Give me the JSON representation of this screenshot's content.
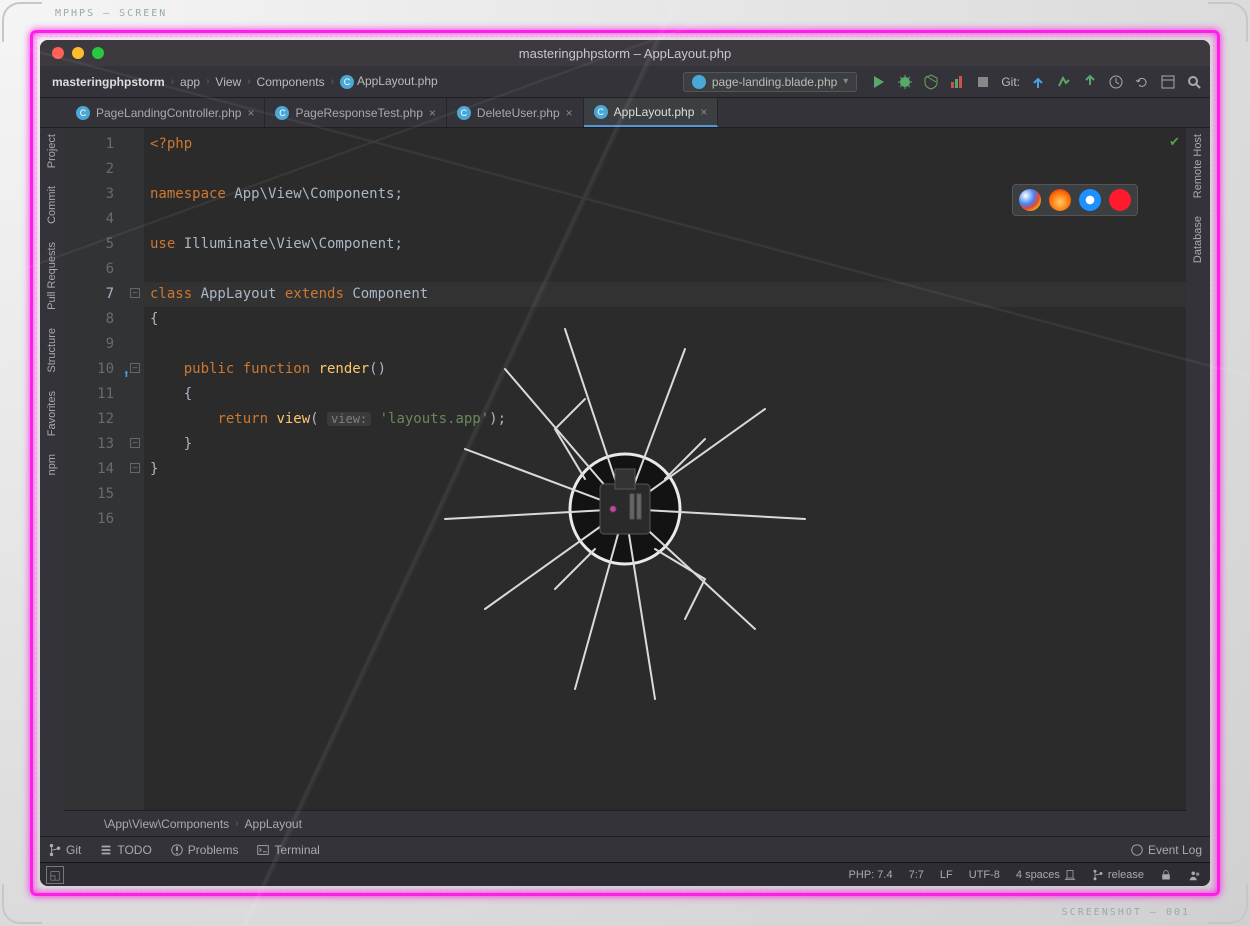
{
  "frame": {
    "label_tl": "MPHPS – SCREEN",
    "label_br": "SCREENSHOT – 001"
  },
  "window": {
    "title": "masteringphpstorm – AppLayout.php"
  },
  "breadcrumbs": [
    "masteringphpstorm",
    "app",
    "View",
    "Components",
    "AppLayout.php"
  ],
  "runconfig": {
    "label": "page-landing.blade.php"
  },
  "git": {
    "label": "Git:"
  },
  "tabs": [
    {
      "label": "PageLandingController.php",
      "active": false
    },
    {
      "label": "PageResponseTest.php",
      "active": false
    },
    {
      "label": "DeleteUser.php",
      "active": false
    },
    {
      "label": "AppLayout.php",
      "active": true
    }
  ],
  "leftrail": [
    {
      "label": "Project",
      "icon": "folder"
    },
    {
      "label": "Commit",
      "icon": "commit"
    },
    {
      "label": "Pull Requests",
      "icon": "pr"
    },
    {
      "label": "Structure",
      "icon": "structure"
    },
    {
      "label": "Favorites",
      "icon": "star"
    },
    {
      "label": "npm",
      "icon": "npm"
    }
  ],
  "rightrail": [
    {
      "label": "Remote Host",
      "icon": "remote"
    },
    {
      "label": "Database",
      "icon": "database"
    }
  ],
  "code": {
    "lines": [
      {
        "n": 1,
        "seg": [
          [
            "kw",
            "<?php"
          ]
        ]
      },
      {
        "n": 2,
        "seg": []
      },
      {
        "n": 3,
        "seg": [
          [
            "kw",
            "namespace "
          ],
          [
            "ns",
            "App\\View\\Components"
          ],
          [
            "pun",
            ";"
          ]
        ]
      },
      {
        "n": 4,
        "seg": []
      },
      {
        "n": 5,
        "seg": [
          [
            "kw",
            "use "
          ],
          [
            "ns",
            "Illuminate\\View\\Component"
          ],
          [
            "pun",
            ";"
          ]
        ]
      },
      {
        "n": 6,
        "seg": []
      },
      {
        "n": 7,
        "hl": true,
        "fold": true,
        "seg": [
          [
            "kw",
            "class "
          ],
          [
            "cls",
            "AppLayout "
          ],
          [
            "kw",
            "extends "
          ],
          [
            "ns",
            "Component"
          ]
        ]
      },
      {
        "n": 8,
        "seg": [
          [
            "pun",
            "{"
          ]
        ]
      },
      {
        "n": 9,
        "seg": []
      },
      {
        "n": 10,
        "override": true,
        "fold": true,
        "seg": [
          [
            "pun",
            "    "
          ],
          [
            "kw",
            "public function "
          ],
          [
            "fn",
            "render"
          ],
          [
            "pun",
            "()"
          ]
        ]
      },
      {
        "n": 11,
        "seg": [
          [
            "pun",
            "    {"
          ]
        ]
      },
      {
        "n": 12,
        "seg": [
          [
            "pun",
            "        "
          ],
          [
            "kw",
            "return "
          ],
          [
            "fn",
            "view"
          ],
          [
            "pun",
            "( "
          ],
          [
            "param",
            "view:"
          ],
          [
            "pun",
            " "
          ],
          [
            "str",
            "'layouts.app'"
          ],
          [
            "pun",
            ");"
          ]
        ]
      },
      {
        "n": 13,
        "fold": true,
        "seg": [
          [
            "pun",
            "    }"
          ]
        ]
      },
      {
        "n": 14,
        "fold": true,
        "seg": [
          [
            "pun",
            "}"
          ]
        ]
      },
      {
        "n": 15,
        "seg": []
      },
      {
        "n": 16,
        "seg": []
      }
    ]
  },
  "editor_breadcrumbs": [
    "\\App\\View\\Components",
    "AppLayout"
  ],
  "toolwindows": [
    {
      "label": "Git",
      "icon": "branch"
    },
    {
      "label": "TODO",
      "icon": "list"
    },
    {
      "label": "Problems",
      "icon": "warn"
    },
    {
      "label": "Terminal",
      "icon": "terminal"
    }
  ],
  "eventlog": {
    "label": "Event Log"
  },
  "status": {
    "php": "PHP: 7.4",
    "pos": "7:7",
    "le": "LF",
    "enc": "UTF-8",
    "indent": "4 spaces",
    "branch": "release"
  }
}
